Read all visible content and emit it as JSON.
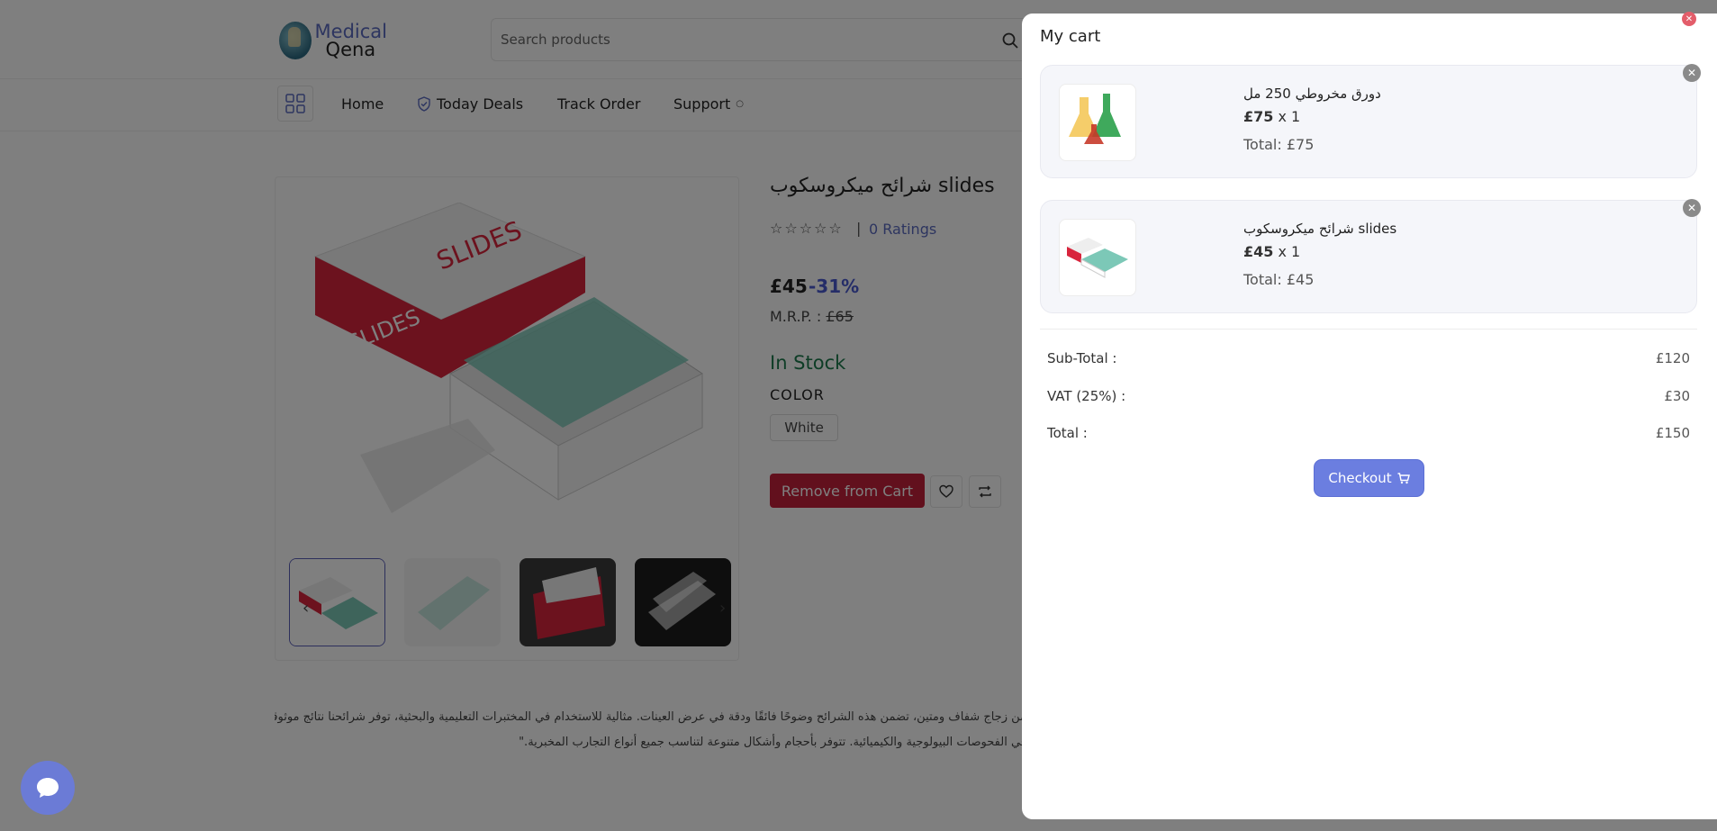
{
  "header": {
    "logo_line1": "Medical",
    "logo_line2": "Qena",
    "search_placeholder": "Search products"
  },
  "nav": {
    "items": [
      {
        "label": "Home"
      },
      {
        "label": "Today Deals"
      },
      {
        "label": "Track Order"
      },
      {
        "label": "Support"
      }
    ]
  },
  "product": {
    "title": "شرائح ميكروسكوب slides",
    "stars": "☆☆☆☆☆",
    "separator": "|",
    "ratings": "0 Ratings",
    "price": "£45",
    "discount": "-31%",
    "mrp_label": "M.R.P. :",
    "mrp_value": "£65",
    "stock": "In Stock",
    "color_label": "COLOR",
    "color_option": "White",
    "remove_label": "Remove from Cart",
    "description": [
      "من زجاج شفاف ومتين، تضمن هذه الشرائح وضوحًا فائقًا ودقة في عرض العينات. مثالية للاستخدام في المختبرات التعليمية والبحثية، توفر شرائحنا نتائج موثوقة",
      "في الفحوصات البيولوجية والكيميائية. تتوفر بأحجام وأشكال متنوعة لتناسب جميع أنواع التجارب المخبرية.\""
    ],
    "image_label_top": "SLIDES",
    "image_label_side": "SLIDES"
  },
  "cart": {
    "title": "My cart",
    "items": [
      {
        "name": "دورق مخروطي 250 مل",
        "price": "£75",
        "qty": "x 1",
        "total": "Total: £75"
      },
      {
        "name": "شرائح ميكروسكوب slides",
        "price": "£45",
        "qty": "x 1",
        "total": "Total: £45"
      }
    ],
    "summary": {
      "subtotal_label": "Sub-Total :",
      "subtotal_value": "£120",
      "vat_label": "VAT (25%) :",
      "vat_value": "£30",
      "total_label": "Total :",
      "total_value": "£150"
    },
    "checkout_label": "Checkout"
  },
  "colors": {
    "accent": "#6b7ee0",
    "remove": "#c4203a",
    "stock": "#1d7b4d",
    "discount": "#4a5bd0"
  }
}
